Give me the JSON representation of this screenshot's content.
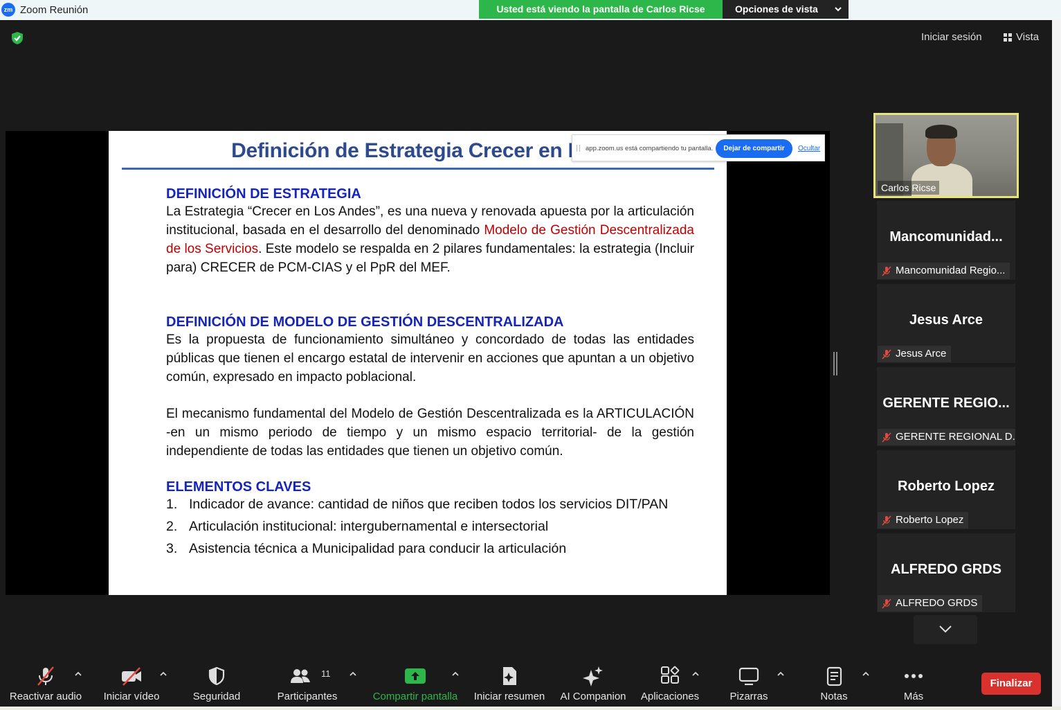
{
  "window": {
    "app_icon_text": "zm",
    "title": "Zoom Reunión"
  },
  "banner": {
    "viewing_text": "Usted está viendo la pantalla de Carlos Ricse",
    "view_options": "Opciones de vista"
  },
  "header": {
    "signin": "Iniciar sesión",
    "view": "Vista"
  },
  "slide": {
    "title": "Definición de Estrategia Crecer en Los",
    "section1_heading": "DEFINICIÓN DE ESTRATEGIA",
    "section1_text_a": "La Estrategia “Crecer en Los Andes”, es una nueva y renovada apuesta por la articulación institucional, basada en el desarrollo del denominado ",
    "section1_text_red": "Modelo de Gestión Descentralizada de los Servicios",
    "section1_text_b": ". Este modelo se respalda en 2 pilares fundamentales: la estrategia (Incluir para) CRECER de PCM-CIAS y el PpR del MEF.",
    "section2_heading": "DEFINICIÓN DE MODELO DE GESTIÓN DESCENTRALIZADA",
    "section2_text": "Es la propuesta de funcionamiento simultáneo y concordado de todas las entidades públicas que tienen el encargo estatal de intervenir en acciones que apuntan a un objetivo común, expresado en impacto poblacional.",
    "section3_text": "El mecanismo fundamental del Modelo de Gestión Descentralizada es la ARTICULACIÓN -en un mismo periodo de tiempo y un mismo espacio territorial- de la gestión independiente de todas las entidades que tienen un objetivo común.",
    "section4_heading": "ELEMENTOS CLAVES",
    "items": [
      {
        "num": "1.",
        "text": "Indicador de avance: cantidad de niños que reciben todos los servicios DIT/PAN"
      },
      {
        "num": "2.",
        "text": "Articulación institucional: intergubernamental e intersectorial"
      },
      {
        "num": "3.",
        "text": "Asistencia técnica a Municipalidad para conducir la articulación"
      }
    ]
  },
  "share_popup": {
    "message": "app.zoom.us está compartiendo tu pantalla.",
    "stop": "Dejar de compartir",
    "hide": "Ocultar"
  },
  "participants": {
    "self": {
      "name": "Carlos Ricse"
    },
    "tiles": [
      {
        "big": "Mancomunidad...",
        "label": "Mancomunidad Regio..."
      },
      {
        "big": "Jesus Arce",
        "label": "Jesus Arce"
      },
      {
        "big": "GERENTE  REGIO...",
        "label": "GERENTE REGIONAL D..."
      },
      {
        "big": "Roberto Lopez",
        "label": "Roberto Lopez"
      },
      {
        "big": "ALFREDO GRDS",
        "label": "ALFREDO GRDS"
      }
    ]
  },
  "toolbar": {
    "audio": "Reactivar audio",
    "video": "Iniciar vídeo",
    "security": "Seguridad",
    "participants": "Participantes",
    "participants_count": "11",
    "share": "Compartir pantalla",
    "summary": "Iniciar resumen",
    "companion": "AI Companion",
    "apps": "Aplicaciones",
    "whiteboards": "Pizarras",
    "notes": "Notas",
    "more": "Más",
    "end": "Finalizar"
  },
  "colors": {
    "accent_green": "#2db64a",
    "end_red": "#d9322e",
    "slide_heading_blue": "#1525b8",
    "slide_title_blue": "#2c4a8c",
    "slide_red": "#c00000",
    "active_speaker_border": "#e8e37b"
  },
  "icons": [
    "shield-check-icon",
    "muted-mic-icon",
    "video-off-icon",
    "security-shield-icon",
    "participants-icon",
    "share-screen-icon",
    "summary-icon",
    "sparkle-icon",
    "apps-icon",
    "whiteboard-icon",
    "notes-icon",
    "more-dots-icon",
    "chevron-down-icon"
  ]
}
